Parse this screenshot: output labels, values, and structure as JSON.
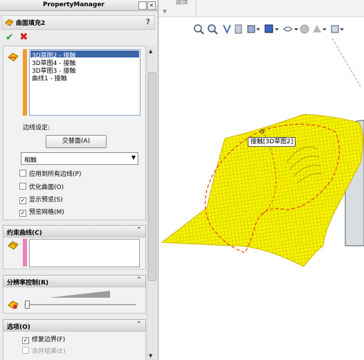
{
  "panel": {
    "title": "PropertyManager",
    "close_glyph": "×",
    "feature_title": "曲面填充2",
    "help_glyph": "?",
    "ok_glyph": "✔",
    "cancel_glyph": "✖"
  },
  "boundary": {
    "items": [
      "3D草图2 - 接触",
      "3D草图4 - 接触",
      "3D草图3 - 接触",
      "曲线1 - 接触"
    ],
    "edge_settings_label": "边线设定:",
    "swap_button": "交替面(A)",
    "condition_value": "相触",
    "options": [
      {
        "label": "应用到所有边线(P)",
        "checked": false
      },
      {
        "label": "优化曲面(O)",
        "checked": false
      },
      {
        "label": "显示预览(S)",
        "checked": true
      },
      {
        "label": "预览网格(M)",
        "checked": true
      }
    ]
  },
  "constraint": {
    "title": "约束曲线(C)",
    "collapse_glyph": "⌃"
  },
  "resolution": {
    "title": "分辨率控制(R)",
    "collapse_glyph": "⌃"
  },
  "options_group": {
    "title": "选项(O)",
    "collapse_glyph": "⌃",
    "items": [
      {
        "label": "修复边界(F)",
        "checked": true,
        "disabled": false
      },
      {
        "label": "合并结果(E)",
        "checked": false,
        "disabled": true
      }
    ]
  },
  "viewport": {
    "top_label": "曲体",
    "callout": "接触[3D草图2]",
    "icons": [
      "zoom-fit-icon",
      "zoom-area-icon",
      "previous-view-icon",
      "section-view-icon",
      "view-orientation-icon",
      "display-style-icon",
      "hide-show-icon",
      "appearance-icon",
      "scene-icon",
      "view-settings-icon"
    ],
    "surface_color": "#ffff33"
  },
  "colors": {
    "boundary_bar": "#f29a2e",
    "constraint_bar": "#e882b8",
    "accent": "#3a66a8"
  }
}
